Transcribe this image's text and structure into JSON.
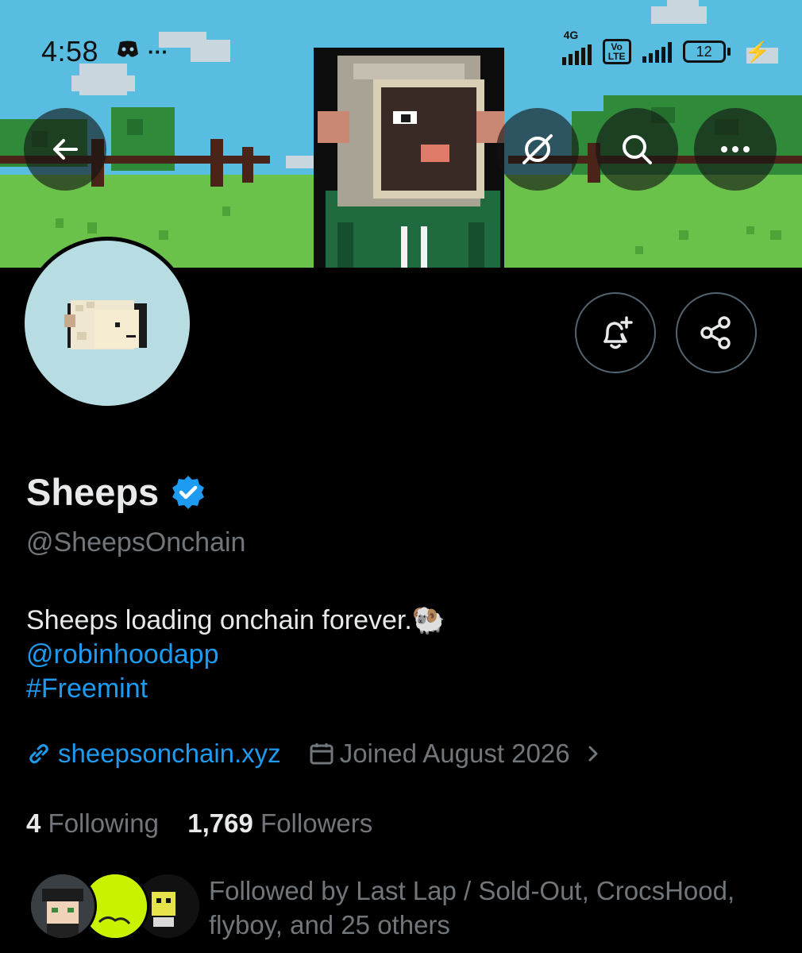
{
  "status_bar": {
    "time": "4:58",
    "network_type": "4G",
    "volte_label": "Vo LTE",
    "battery_level": "12"
  },
  "header": {
    "back_icon": "arrow-left-icon",
    "grok_icon": "grok-icon",
    "search_icon": "search-icon",
    "more_icon": "more-horizontal-icon"
  },
  "actions": {
    "notify_icon": "bell-plus-icon",
    "share_icon": "share-icon"
  },
  "profile": {
    "name": "Sheeps",
    "verified": true,
    "handle": "@SheepsOnchain",
    "bio_text": "Sheeps loading onchain forever.🐏",
    "bio_mention": "@robinhoodapp",
    "bio_hashtag": "#Freemint",
    "website": "sheepsonchain.xyz",
    "joined": "Joined August 2026",
    "following_count": "4",
    "following_label": "Following",
    "followers_count": "1,769",
    "followers_label": "Followers",
    "followed_by": "Followed by Last Lap / Sold-Out, CrocsHood, flyboy, and 25 others"
  },
  "colors": {
    "accent": "#1d9bf0",
    "background": "#000000",
    "secondary_text": "#71767b",
    "avatar_bg": "#b7dde2"
  }
}
